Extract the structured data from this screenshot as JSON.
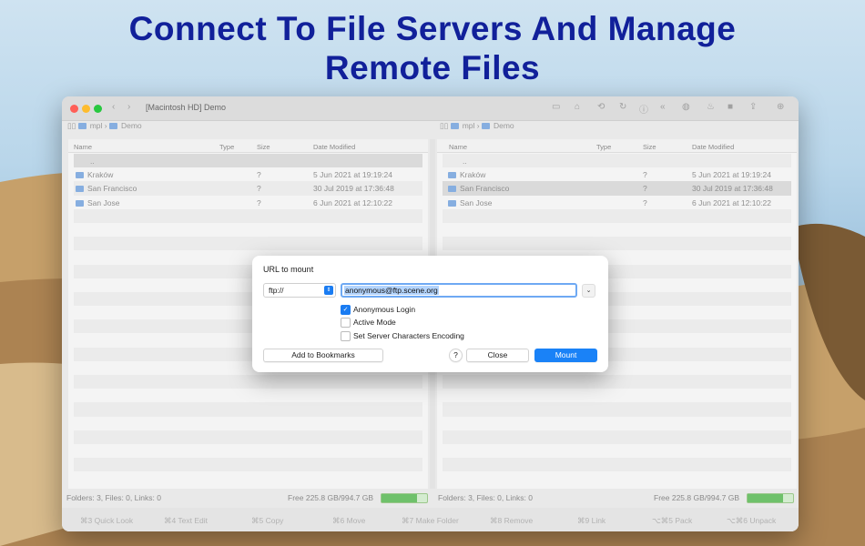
{
  "headline": {
    "line1": "Connect To File Servers And Manage",
    "line2": "Remote Files"
  },
  "window": {
    "title": "[Macintosh HD] Demo",
    "toolbar_icons": [
      "monitor-icon",
      "home-icon",
      "refresh-icon",
      "info-icon",
      "back-double-icon",
      "globe-icon",
      "flame-icon",
      "stop-icon",
      "share-icon",
      "download-icon"
    ]
  },
  "left_pane": {
    "path": [
      "mpl",
      "Demo"
    ],
    "columns": {
      "name": "Name",
      "type": "Type",
      "size": "Size",
      "date": "Date Modified"
    },
    "rows": [
      {
        "name": "..",
        "size": "",
        "date": ""
      },
      {
        "name": "Kraków",
        "size": "?",
        "date": "5 Jun 2021 at 19:19:24"
      },
      {
        "name": "San Francisco",
        "size": "?",
        "date": "30 Jul 2019 at 17:36:48"
      },
      {
        "name": "San Jose",
        "size": "?",
        "date": "6 Jun 2021 at 12:10:22"
      }
    ],
    "status": "Folders: 3, Files: 0, Links: 0",
    "free": "Free 225.8 GB/994.7 GB",
    "used_fraction": 0.77
  },
  "right_pane": {
    "path": [
      "mpl",
      "Demo"
    ],
    "columns": {
      "name": "Name",
      "type": "Type",
      "size": "Size",
      "date": "Date Modified"
    },
    "rows": [
      {
        "name": "..",
        "size": "",
        "date": ""
      },
      {
        "name": "Kraków",
        "size": "?",
        "date": "5 Jun 2021 at 19:19:24"
      },
      {
        "name": "San Francisco",
        "size": "?",
        "date": "30 Jul 2019 at 17:36:48"
      },
      {
        "name": "San Jose",
        "size": "?",
        "date": "6 Jun 2021 at 12:10:22"
      }
    ],
    "status": "Folders: 3, Files: 0, Links: 0",
    "free": "Free 225.8 GB/994.7 GB",
    "used_fraction": 0.77
  },
  "function_bar": [
    "⌘3 Quick Look",
    "⌘4 Text Edit",
    "⌘5 Copy",
    "⌘6 Move",
    "⌘7 Make Folder",
    "⌘8 Remove",
    "⌘9 Link",
    "⌥⌘5 Pack",
    "⌥⌘6 Unpack"
  ],
  "dialog": {
    "title": "URL to mount",
    "protocol": "ftp://",
    "url": "anonymous@ftp.scene.org",
    "options": [
      {
        "label": "Anonymous Login",
        "checked": true
      },
      {
        "label": "Active Mode",
        "checked": false
      },
      {
        "label": "Set Server Characters Encoding",
        "checked": false
      }
    ],
    "add_bookmark": "Add to Bookmarks",
    "help": "?",
    "close": "Close",
    "mount": "Mount"
  },
  "colors": {
    "headline": "#11209a",
    "accent": "#1a82f7",
    "free_bar": "#6fc16b"
  }
}
